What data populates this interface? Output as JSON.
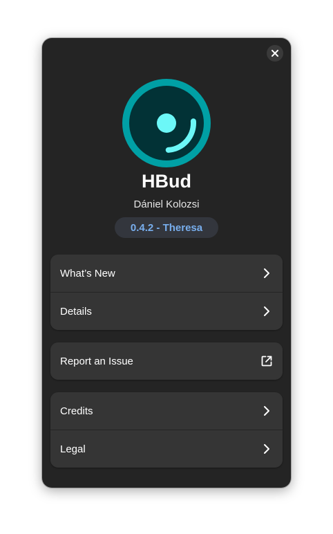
{
  "dialog": {
    "close_icon": "window-close-icon"
  },
  "app": {
    "name": "HBud",
    "developer": "Dániel Kolozsi",
    "version": "0.4.2 - Theresa",
    "icon": "hbud-app-icon"
  },
  "groups": [
    {
      "rows": [
        {
          "label": "What’s New",
          "icon": "chevron-right-icon"
        },
        {
          "label": "Details",
          "icon": "chevron-right-icon"
        }
      ]
    },
    {
      "rows": [
        {
          "label": "Report an Issue",
          "icon": "external-link-icon"
        }
      ]
    },
    {
      "rows": [
        {
          "label": "Credits",
          "icon": "chevron-right-icon"
        },
        {
          "label": "Legal",
          "icon": "chevron-right-icon"
        }
      ]
    }
  ],
  "colors": {
    "dialog_bg": "#242424",
    "row_bg": "#353535",
    "accent_blue": "#78aeed",
    "icon_teal": "#00a0a5",
    "icon_cyan": "#6cf7f7"
  }
}
